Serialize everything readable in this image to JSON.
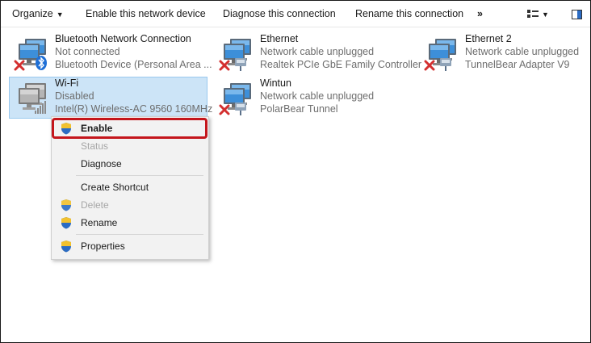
{
  "toolbar": {
    "organize": "Organize",
    "enable_device": "Enable this network device",
    "diagnose": "Diagnose this connection",
    "rename": "Rename this connection",
    "more": "»"
  },
  "adapters": [
    {
      "name": "Bluetooth Network Connection",
      "status": "Not connected",
      "device": "Bluetooth Device (Personal Area ..."
    },
    {
      "name": "Ethernet",
      "status": "Network cable unplugged",
      "device": "Realtek PCIe GbE Family Controller"
    },
    {
      "name": "Ethernet 2",
      "status": "Network cable unplugged",
      "device": "TunnelBear Adapter V9"
    },
    {
      "name": "Wi-Fi",
      "status": "Disabled",
      "device": "Intel(R) Wireless-AC 9560 160MHz"
    },
    {
      "name": "Wintun",
      "status": "Network cable unplugged",
      "device": "PolarBear Tunnel"
    }
  ],
  "context_menu": {
    "items": [
      {
        "label": "Enable"
      },
      {
        "label": "Status"
      },
      {
        "label": "Diagnose"
      },
      {
        "label": "Create Shortcut"
      },
      {
        "label": "Delete"
      },
      {
        "label": "Rename"
      },
      {
        "label": "Properties"
      }
    ]
  },
  "colors": {
    "selection_bg": "#cce4f7",
    "highlight_border": "#c4161c",
    "error_red": "#d32f2f"
  }
}
